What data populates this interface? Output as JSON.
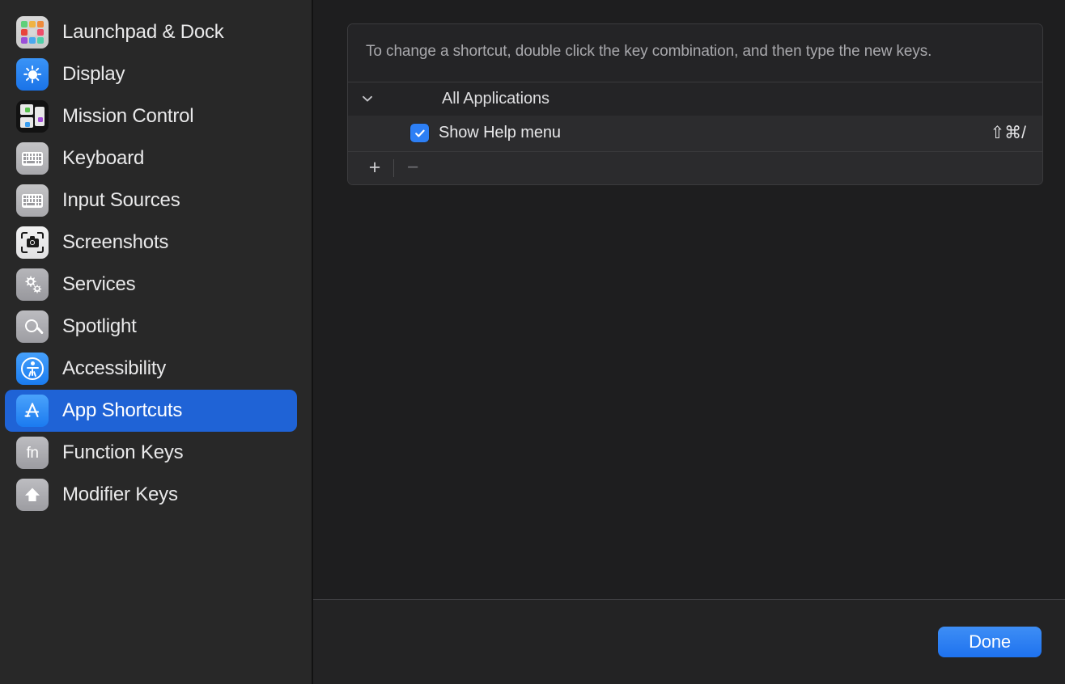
{
  "sidebar": {
    "items": [
      {
        "label": "Launchpad & Dock",
        "icon": "launchpad-icon",
        "selected": false
      },
      {
        "label": "Display",
        "icon": "display-brightness-icon",
        "selected": false
      },
      {
        "label": "Mission Control",
        "icon": "mission-control-icon",
        "selected": false
      },
      {
        "label": "Keyboard",
        "icon": "keyboard-icon",
        "selected": false
      },
      {
        "label": "Input Sources",
        "icon": "input-sources-keyboard-icon",
        "selected": false
      },
      {
        "label": "Screenshots",
        "icon": "screenshot-camera-icon",
        "selected": false
      },
      {
        "label": "Services",
        "icon": "services-gears-icon",
        "selected": false
      },
      {
        "label": "Spotlight",
        "icon": "spotlight-search-icon",
        "selected": false
      },
      {
        "label": "Accessibility",
        "icon": "accessibility-icon",
        "selected": false
      },
      {
        "label": "App Shortcuts",
        "icon": "app-shortcuts-icon",
        "selected": true
      },
      {
        "label": "Function Keys",
        "icon": "function-keys-fn-icon",
        "selected": false
      },
      {
        "label": "Modifier Keys",
        "icon": "modifier-keys-shift-arrow-icon",
        "selected": false
      }
    ]
  },
  "panel": {
    "help_text": "To change a shortcut, double click the key combination, and then type the new keys.",
    "group": {
      "label": "All Applications",
      "expanded": true,
      "disclosure_icon": "chevron-down-icon"
    },
    "rows": [
      {
        "enabled": true,
        "checkbox_icon": "checkmark-icon",
        "title": "Show Help menu",
        "shortcut": "⇧⌘/"
      }
    ],
    "footer": {
      "add_label": "+",
      "remove_label": "−"
    }
  },
  "bottom_bar": {
    "done_label": "Done"
  },
  "colors": {
    "accent_blue": "#1f63d6",
    "checkbox_blue": "#2d7ff5",
    "done_button_blue": "#1e72ef",
    "sidebar_bg": "#282828",
    "content_bg": "#1e1e1f"
  }
}
